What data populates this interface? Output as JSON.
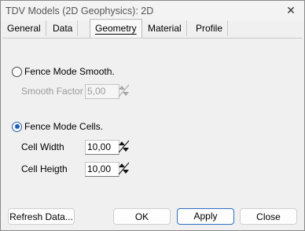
{
  "window": {
    "title": "TDV Models (2D Geophysics): 2D",
    "close_glyph": "✕"
  },
  "tabs": [
    {
      "label": "General",
      "active": false
    },
    {
      "label": "Data",
      "active": false
    },
    {
      "label": "Geometry",
      "active": true
    },
    {
      "label": "Material",
      "active": false
    },
    {
      "label": "Profile",
      "active": false
    }
  ],
  "geometry": {
    "smooth": {
      "radio_label": "Fence Mode Smooth.",
      "selected": false,
      "factor_label": "Smooth Factor",
      "factor_value": "5,00",
      "enabled": false
    },
    "cells": {
      "radio_label": "Fence Mode Cells.",
      "selected": true,
      "width_label": "Cell Width",
      "width_value": "10,00",
      "height_label": "Cell Heigth",
      "height_value": "10,00"
    }
  },
  "buttons": {
    "refresh": "Refresh Data...",
    "ok": "OK",
    "apply": "Apply",
    "close": "Close"
  },
  "colors": {
    "accent": "#1f5fb5",
    "disabled_text": "#9a9a9a"
  }
}
